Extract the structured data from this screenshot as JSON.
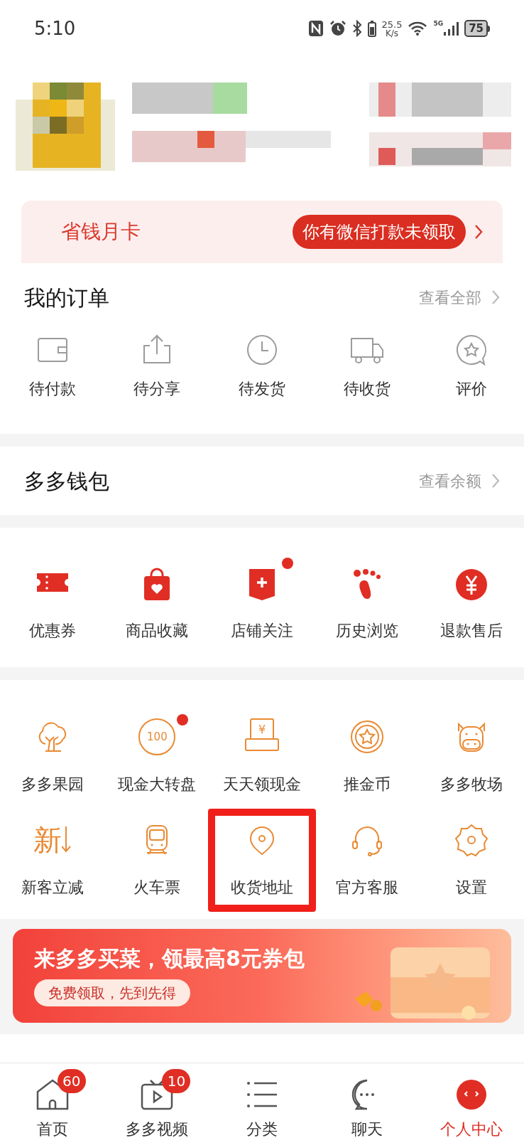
{
  "status_bar": {
    "time": "5:10",
    "net_speed": "25.5",
    "net_unit": "K/s",
    "network": "5G",
    "battery": "75"
  },
  "savings_card": {
    "title": "省钱月卡",
    "notice": "你有微信打款未领取"
  },
  "orders": {
    "title": "我的订单",
    "link": "查看全部",
    "items": [
      {
        "label": "待付款"
      },
      {
        "label": "待分享"
      },
      {
        "label": "待发货"
      },
      {
        "label": "待收货"
      },
      {
        "label": "评价"
      }
    ]
  },
  "wallet": {
    "title": "多多钱包",
    "link": "查看余额"
  },
  "shortcuts": [
    {
      "label": "优惠券",
      "dot": false
    },
    {
      "label": "商品收藏",
      "dot": false
    },
    {
      "label": "店铺关注",
      "dot": true
    },
    {
      "label": "历史浏览",
      "dot": false
    },
    {
      "label": "退款售后",
      "dot": false
    }
  ],
  "services": [
    {
      "label": "多多果园",
      "dot": false,
      "highlighted": false
    },
    {
      "label": "现金大转盘",
      "dot": true,
      "highlighted": false,
      "icon_text": "100"
    },
    {
      "label": "天天领现金",
      "dot": false,
      "highlighted": false,
      "icon_text": "¥"
    },
    {
      "label": "推金币",
      "dot": false,
      "highlighted": false
    },
    {
      "label": "多多牧场",
      "dot": false,
      "highlighted": false
    },
    {
      "label": "新客立减",
      "dot": false,
      "highlighted": false,
      "icon_text": "新"
    },
    {
      "label": "火车票",
      "dot": false,
      "highlighted": false
    },
    {
      "label": "收货地址",
      "dot": false,
      "highlighted": true
    },
    {
      "label": "官方客服",
      "dot": false,
      "highlighted": false
    },
    {
      "label": "设置",
      "dot": false,
      "highlighted": false
    }
  ],
  "banner": {
    "title": "来多多买菜，领最高8元券包",
    "subtitle": "免费领取，先到先得"
  },
  "tab_bar": [
    {
      "label": "首页",
      "badge": "60",
      "selected": false
    },
    {
      "label": "多多视频",
      "badge": "10",
      "selected": false
    },
    {
      "label": "分类",
      "selected": false
    },
    {
      "label": "聊天",
      "selected": false
    },
    {
      "label": "个人中心",
      "selected": true
    }
  ]
}
